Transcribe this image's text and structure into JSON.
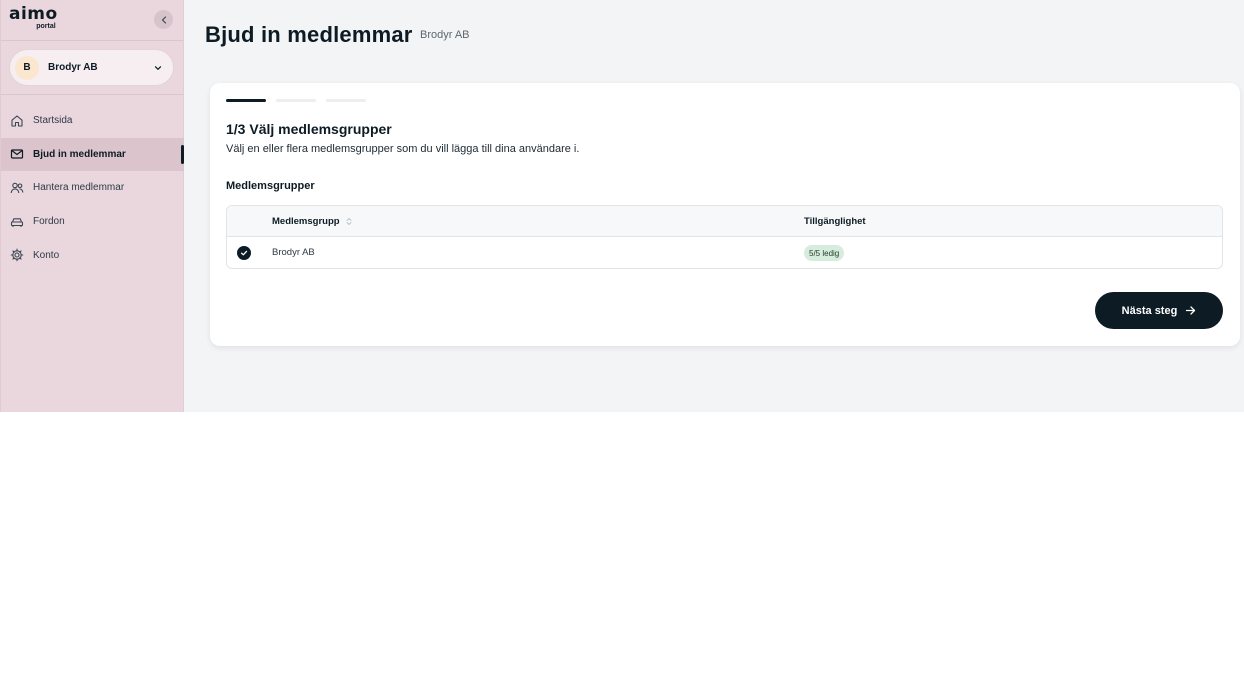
{
  "brand": {
    "name": "aimo",
    "sub": "portal"
  },
  "org": {
    "initial": "B",
    "name": "Brodyr AB"
  },
  "nav": [
    {
      "label": "Startsida",
      "icon": "home-icon",
      "active": false
    },
    {
      "label": "Bjud in medlemmar",
      "icon": "mail-icon",
      "active": true
    },
    {
      "label": "Hantera medlemmar",
      "icon": "users-icon",
      "active": false
    },
    {
      "label": "Fordon",
      "icon": "car-icon",
      "active": false
    },
    {
      "label": "Konto",
      "icon": "gear-icon",
      "active": false
    }
  ],
  "header": {
    "title": "Bjud in medlemmar",
    "subtitle": "Brodyr AB"
  },
  "wizard": {
    "steps_total": 3,
    "current_step": 1,
    "title": "1/3 Välj medlemsgrupper",
    "description": "Välj en eller flera medlemsgrupper som du vill lägga till dina användare i.",
    "section_title": "Medlemsgrupper"
  },
  "table": {
    "columns": [
      "Medlemsgrupp",
      "Tillgänglighet"
    ],
    "rows": [
      {
        "selected": true,
        "name": "Brodyr AB",
        "availability": "5/5 ledig"
      }
    ]
  },
  "actions": {
    "next_label": "Nästa steg"
  },
  "colors": {
    "sidebar": "#ead7de",
    "primary": "#0d1b24",
    "badge": "#d6ecdd",
    "background": "#f3f4f6"
  }
}
